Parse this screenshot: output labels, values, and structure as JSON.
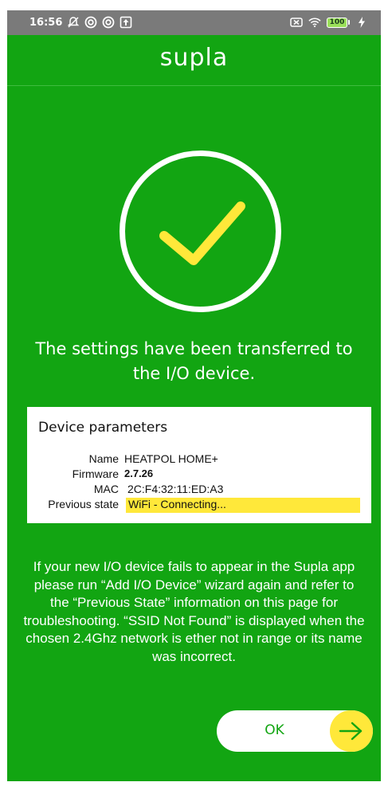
{
  "status_bar": {
    "time": "16:56",
    "battery_level": "100",
    "left_icons": [
      "notifications-off-icon",
      "sync-icon",
      "sync-icon",
      "upload-icon"
    ],
    "right_icons": [
      "sim-off-icon",
      "wifi-icon",
      "battery-icon",
      "charging-icon"
    ]
  },
  "header": {
    "logo": "supla"
  },
  "main": {
    "success_icon": "checkmark-circle-icon",
    "message": "The settings have been transferred to the I/O device."
  },
  "device_parameters": {
    "title": "Device parameters",
    "rows": [
      {
        "label": "Name",
        "value": "HEATPOL HOME+"
      },
      {
        "label": "Firmware",
        "value": "2.7.26"
      },
      {
        "label": "MAC",
        "value": "2C:F4:32:11:ED:A3"
      },
      {
        "label": "Previous state",
        "value": "WiFi - Connecting..."
      }
    ]
  },
  "help": {
    "text": "If your new I/O device fails to appear in the Supla app please run “Add I/O Device” wizard again and refer to the “Previous State” information on this page for troubleshooting. “SSID Not Found” is displayed when the chosen 2.4Ghz network is ether not in range or its name was incorrect."
  },
  "ok_button": {
    "label": "OK",
    "icon": "arrow-right-icon"
  },
  "colors": {
    "background": "#12a512",
    "accent": "#ffe83a",
    "status_bar": "#7a7a7a"
  }
}
